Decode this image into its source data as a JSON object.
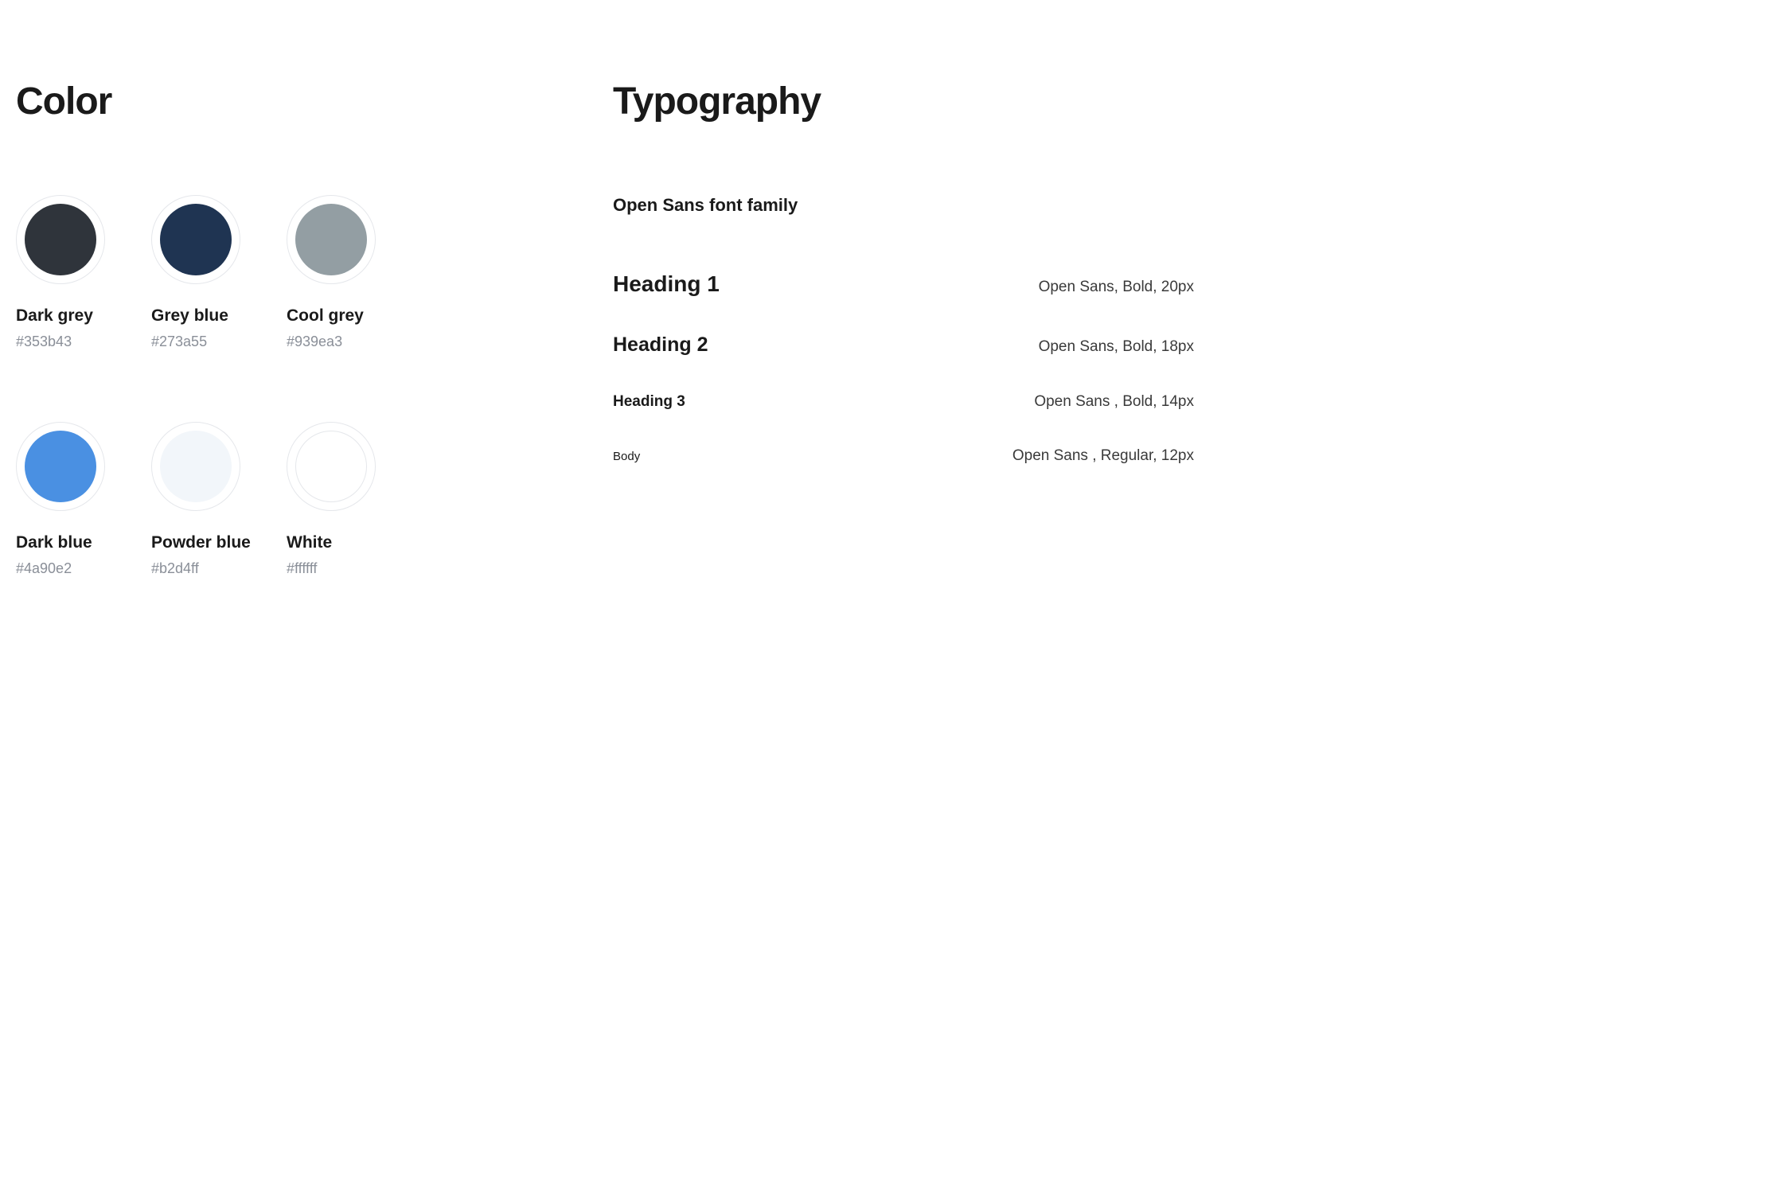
{
  "color_section": {
    "title": "Color",
    "swatches": [
      {
        "name": "Dark grey",
        "hex": "#353b43"
      },
      {
        "name": "Grey blue",
        "hex": "#273a55"
      },
      {
        "name": "Cool grey",
        "hex": "#939ea3"
      },
      {
        "name": "Dark blue",
        "hex": "#4a90e2"
      },
      {
        "name": "Powder blue",
        "hex": "#b2d4ff"
      },
      {
        "name": "White",
        "hex": "#ffffff"
      }
    ],
    "actual_swatch_colors": [
      "#2f343b",
      "#1f3452",
      "#939ea3",
      "#4a90e2",
      "#f2f6fa",
      "#ffffff"
    ]
  },
  "typography_section": {
    "title": "Typography",
    "font_family_label": "Open Sans font family",
    "rows": [
      {
        "sample": "Heading 1",
        "spec": "Open Sans, Bold, 20px",
        "class": "h1"
      },
      {
        "sample": "Heading 2",
        "spec": "Open Sans, Bold, 18px",
        "class": "h2"
      },
      {
        "sample": "Heading 3",
        "spec": "Open Sans , Bold, 14px",
        "class": "h3"
      },
      {
        "sample": "Body",
        "spec": "Open Sans , Regular, 12px",
        "class": "body"
      }
    ]
  }
}
